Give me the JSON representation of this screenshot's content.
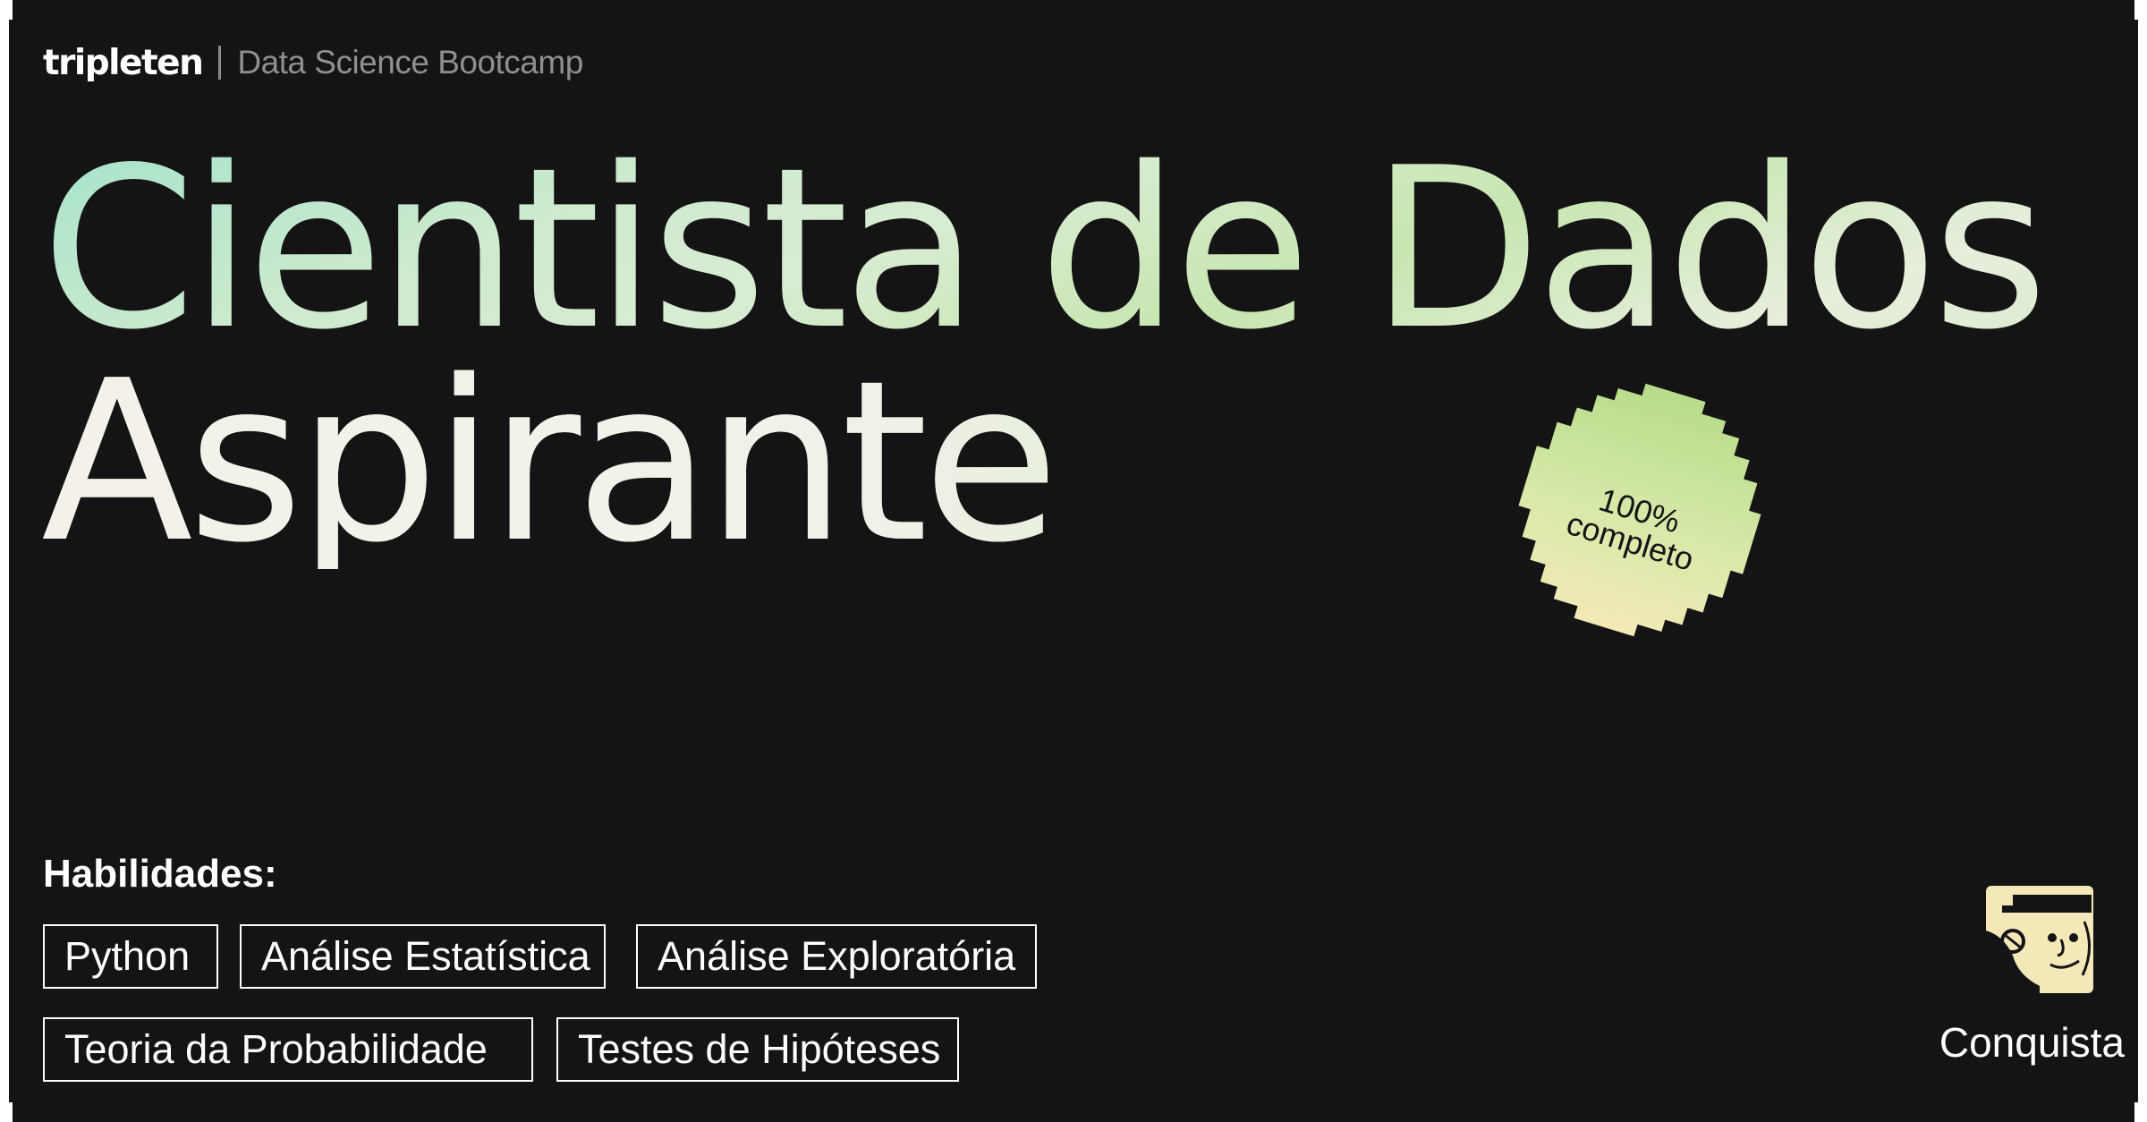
{
  "header": {
    "brand": "tripleten",
    "program": "Data Science Bootcamp"
  },
  "headline": {
    "line1": "Cientista de Dados",
    "line2": "Aspirante"
  },
  "badge": {
    "percent": "100%",
    "status": "completo",
    "icon": "check-circle-icon",
    "color": "#c9e6a4"
  },
  "skills": {
    "title": "Habilidades:",
    "items": [
      "Python",
      "Análise Estatística",
      "Análise Exploratória",
      "Teoria da Probabilidade",
      "Testes de Hipóteses"
    ]
  },
  "achievement": {
    "label": "Conquista",
    "icon": "detective-avatar-icon"
  },
  "colors": {
    "background": "#141414",
    "accent_mint": "#a5e3ca",
    "accent_green": "#c7e6b0",
    "badge_yellow": "#f1e7b0"
  }
}
